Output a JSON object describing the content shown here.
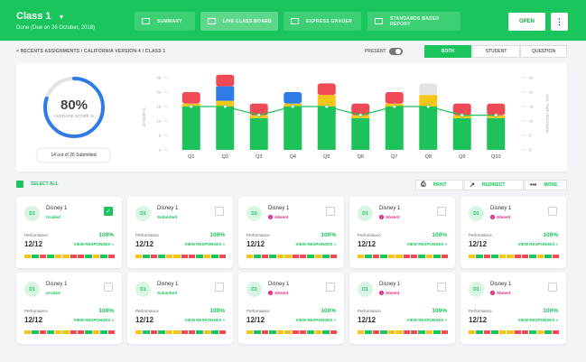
{
  "header": {
    "class_title": "Class 1",
    "due_text": "Done (Due on 26 October, 2018)",
    "tabs": [
      {
        "label": "SUMMARY",
        "active": false
      },
      {
        "label": "LIVE CLASS BOARD",
        "active": true
      },
      {
        "label": "EXPRESS GRADER",
        "active": false
      },
      {
        "label": "STANDARDS BASED REPORT",
        "active": false
      }
    ],
    "open_label": "OPEN",
    "more_label": "⋮"
  },
  "breadcrumb": "< RECENTS ASSIGNMENTS  /  CALIFORNIA VERSION-4  /  CLASS 1",
  "present_label": "PRESENT",
  "segments": [
    "BOTH",
    "STUDENT",
    "QUESTION"
  ],
  "summary": {
    "average_score": "80%",
    "average_score_label": "AVERAGE SCORE %",
    "average_fraction": 0.8,
    "submitted_text": "14 out of 26 Submitted"
  },
  "chart_data": {
    "type": "bar",
    "categories": [
      "Q1",
      "Q2",
      "Q3",
      "Q4",
      "Q5",
      "Q6",
      "Q7",
      "Q8",
      "Q9",
      "Q10"
    ],
    "ylabel": "ATTEMPTS",
    "y2label": "AVG. TIME (SECONDS)",
    "ylim": [
      0,
      20
    ],
    "y_ticks": [
      0,
      5,
      10,
      15,
      20,
      25
    ],
    "y2_ticks": [
      0,
      5,
      10,
      15,
      20,
      25
    ],
    "series": [
      {
        "name": "",
        "color": "#1ec25a",
        "values": [
          15,
          15,
          11,
          15,
          15,
          11,
          15,
          15,
          11,
          11
        ]
      },
      {
        "name": "",
        "color": "#f5c518",
        "values": [
          1,
          2,
          1,
          1,
          4,
          1,
          1,
          4,
          1,
          1
        ]
      },
      {
        "name": "",
        "color": "#2f7be8",
        "values": [
          0,
          5,
          0,
          4,
          0,
          0,
          0,
          0,
          0,
          0
        ]
      },
      {
        "name": "",
        "color": "#f04a55",
        "values": [
          4,
          4,
          4,
          0,
          4,
          4,
          4,
          0,
          4,
          4
        ]
      },
      {
        "name": "",
        "color": "#e3e3e3",
        "values": [
          0,
          0,
          0,
          0,
          0,
          0,
          0,
          4,
          0,
          0
        ]
      }
    ],
    "line": {
      "color": "#1ec25a",
      "values": [
        15,
        15,
        12,
        15,
        15,
        12,
        15,
        15,
        12,
        12
      ]
    }
  },
  "toolbar": {
    "select_all": "SELECT ALL",
    "print": "PRINT",
    "redirect": "REDIRECT",
    "more": "MORE"
  },
  "students": [
    {
      "initials": "D1",
      "name": "Disney 1",
      "status": "Graded",
      "type": "graded",
      "checked": true,
      "perf_label": "Performance",
      "percent": "100%",
      "score": "12/12",
      "view": "VIEW RESPONSES »"
    },
    {
      "initials": "D1",
      "name": "Disney 1",
      "status": "Submitted",
      "type": "graded",
      "checked": false,
      "perf_label": "Performance",
      "percent": "100%",
      "score": "12/12",
      "view": "VIEW RESPONSES »"
    },
    {
      "initials": "D1",
      "name": "Disney 1",
      "status": "Absent",
      "type": "absent",
      "checked": false,
      "perf_label": "Performance",
      "percent": "100%",
      "score": "12/12",
      "view": "VIEW RESPONSES »"
    },
    {
      "initials": "D1",
      "name": "Disney 1",
      "status": "Absent",
      "type": "absent",
      "checked": false,
      "perf_label": "Performance",
      "percent": "100%",
      "score": "12/12",
      "view": "VIEW RESPONSES »"
    },
    {
      "initials": "D1",
      "name": "Disney 1",
      "status": "Absent",
      "type": "absent",
      "checked": false,
      "perf_label": "Performance",
      "percent": "100%",
      "score": "12/12",
      "view": "VIEW RESPONSES »"
    },
    {
      "initials": "D1",
      "name": "Disney 1",
      "status": "Graded",
      "type": "graded",
      "checked": false,
      "perf_label": "Performance",
      "percent": "100%",
      "score": "12/12",
      "view": "VIEW RESPONSES »"
    },
    {
      "initials": "D1",
      "name": "Disney 1",
      "status": "Submitted",
      "type": "graded",
      "checked": false,
      "perf_label": "Performance",
      "percent": "100%",
      "score": "12/12",
      "view": "VIEW RESPONSES »"
    },
    {
      "initials": "D1",
      "name": "Disney 1",
      "status": "Absent",
      "type": "absent",
      "checked": false,
      "perf_label": "Performance",
      "percent": "100%",
      "score": "12/12",
      "view": "VIEW RESPONSES »"
    },
    {
      "initials": "D1",
      "name": "Disney 1",
      "status": "Absent",
      "type": "absent",
      "checked": false,
      "perf_label": "Performance",
      "percent": "100%",
      "score": "12/12",
      "view": "VIEW RESPONSES »"
    },
    {
      "initials": "D1",
      "name": "Disney 1",
      "status": "Absent",
      "type": "absent",
      "checked": false,
      "perf_label": "Performance",
      "percent": "100%",
      "score": "12/12",
      "view": "VIEW RESPONSES »"
    }
  ],
  "segment_colors": [
    "#f5c518",
    "#19c55c",
    "#f04a55",
    "#19c55c",
    "#f5c518",
    "#f5c518",
    "#f04a55",
    "#f04a55",
    "#19c55c",
    "#f5c518",
    "#19c55c",
    "#f04a55"
  ],
  "colors": {
    "accent": "#19c55c",
    "absent": "#e11d79"
  }
}
